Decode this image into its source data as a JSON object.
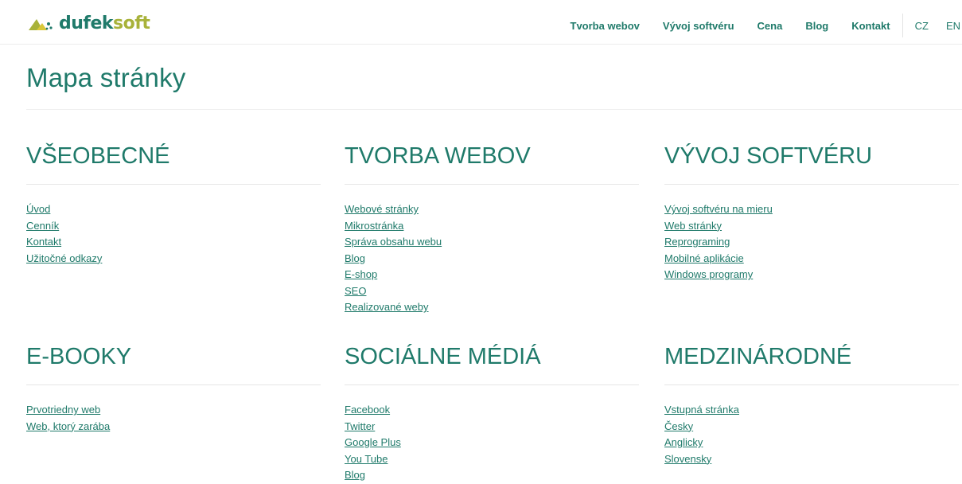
{
  "logo": {
    "part1": "dufek",
    "part2": "soft"
  },
  "nav": {
    "items": [
      {
        "label": "Tvorba webov"
      },
      {
        "label": "Vývoj softvéru"
      },
      {
        "label": "Cena"
      },
      {
        "label": "Blog"
      },
      {
        "label": "Kontakt"
      }
    ],
    "languages": [
      {
        "label": "CZ"
      },
      {
        "label": "EN"
      }
    ]
  },
  "page_title": "Mapa stránky",
  "colors": {
    "accent": "#1f7a6a",
    "logo_secondary": "#a8b23a"
  },
  "sections": [
    {
      "title": "VŠEOBECNÉ",
      "links": [
        "Úvod",
        "Cenník",
        "Kontakt",
        "Užitočné odkazy"
      ]
    },
    {
      "title": "TVORBA WEBOV",
      "links": [
        "Webové stránky",
        "Mikrostránka",
        "Správa obsahu webu",
        "Blog",
        "E-shop",
        "SEO",
        "Realizované weby"
      ]
    },
    {
      "title": "VÝVOJ SOFTVÉRU",
      "links": [
        "Vývoj softvéru na mieru",
        "Web stránky",
        "Reprograming",
        "Mobilné aplikácie",
        "Windows programy"
      ]
    },
    {
      "title": "E-BOOKY",
      "links": [
        "Prvotriedny web",
        "Web, ktorý zarába"
      ]
    },
    {
      "title": "SOCIÁLNE MÉDIÁ",
      "links": [
        "Facebook",
        "Twitter",
        "Google Plus",
        "You Tube",
        "Blog"
      ]
    },
    {
      "title": "MEDZINÁRODNÉ",
      "links": [
        "Vstupná stránka",
        "Česky",
        "Anglicky",
        "Slovensky"
      ]
    }
  ]
}
